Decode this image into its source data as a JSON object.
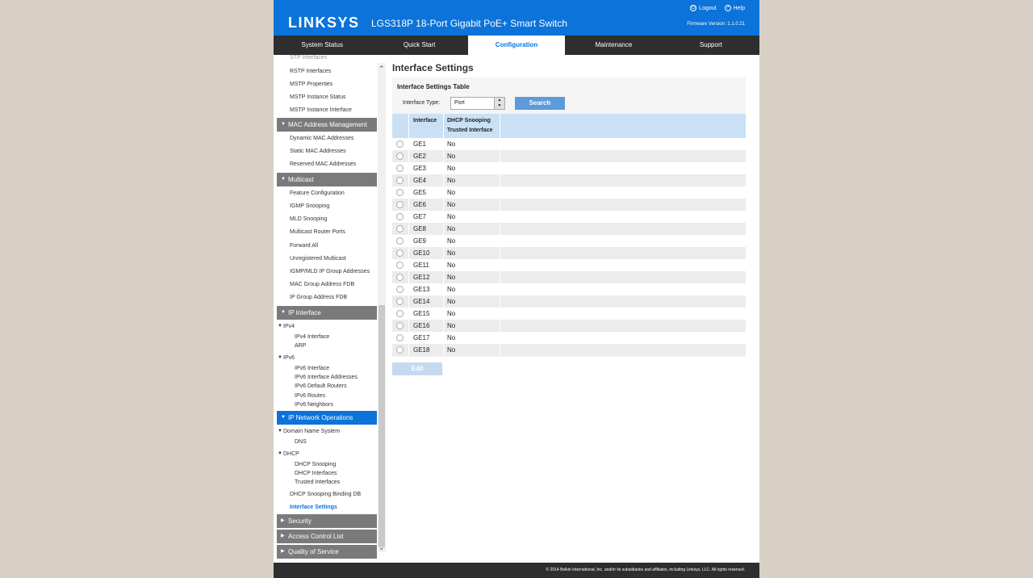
{
  "header": {
    "logo": "LINKSYS",
    "product": "LGS318P 18-Port Gigabit PoE+ Smart Switch",
    "logout": "Logout",
    "help": "Help",
    "firmware": "Firmware Version: 1.1.0.21"
  },
  "tabs": [
    "System Status",
    "Quick Start",
    "Configuration",
    "Maintenance",
    "Support"
  ],
  "active_tab": "Configuration",
  "sidebar": {
    "top_items": [
      "STP Interfaces",
      "RSTP Interfaces",
      "MSTP Properties",
      "MSTP Instance Status",
      "MSTP Instance Interface"
    ],
    "mac_head": "MAC Address Management",
    "mac_items": [
      "Dynamic MAC Addresses",
      "Static MAC Addresses",
      "Reserved MAC Addresses"
    ],
    "multicast_head": "Multicast",
    "multicast_items": [
      "Feature Configuration",
      "IGMP Snooping",
      "MLD Snooping",
      "Multicast Router Ports",
      "Forward All",
      "Unregistered Multicast",
      "IGMP/MLD IP Group Addresses",
      "MAC Group Address FDB",
      "IP Group Address FDB"
    ],
    "ip_head": "IP Interface",
    "ipv4": "IPv4",
    "ipv4_items": [
      "IPv4 Interface",
      "ARP"
    ],
    "ipv6": "IPv6",
    "ipv6_items": [
      "IPv6 Interface",
      "IPv6 Interface Addresses",
      "IPv6 Default Routers",
      "IPv6 Routes",
      "IPv6 Neighbors"
    ],
    "ipnet_head": "IP Network Operations",
    "dns_group": "Domain Name System",
    "dns": "DNS",
    "dhcp_group": "DHCP",
    "dhcp_items": [
      "DHCP Snooping",
      "DHCP Interfaces",
      "Trusted Interfaces"
    ],
    "binding_db": "DHCP Snooping Binding DB",
    "interface_settings": "Interface Settings",
    "security_head": "Security",
    "acl_head": "Access Control List",
    "qos_head": "Quality of Service"
  },
  "main": {
    "title": "Interface Settings",
    "panel_title": "Interface Settings Table",
    "filter_label": "Interface Type:",
    "filter_value": "Port",
    "search_label": "Search",
    "col_interface": "Interface",
    "col_dhcp_1": "DHCP Snooping",
    "col_dhcp_2": "Trusted Interface",
    "rows": [
      {
        "interface": "GE1",
        "trusted": "No"
      },
      {
        "interface": "GE2",
        "trusted": "No"
      },
      {
        "interface": "GE3",
        "trusted": "No"
      },
      {
        "interface": "GE4",
        "trusted": "No"
      },
      {
        "interface": "GE5",
        "trusted": "No"
      },
      {
        "interface": "GE6",
        "trusted": "No"
      },
      {
        "interface": "GE7",
        "trusted": "No"
      },
      {
        "interface": "GE8",
        "trusted": "No"
      },
      {
        "interface": "GE9",
        "trusted": "No"
      },
      {
        "interface": "GE10",
        "trusted": "No"
      },
      {
        "interface": "GE11",
        "trusted": "No"
      },
      {
        "interface": "GE12",
        "trusted": "No"
      },
      {
        "interface": "GE13",
        "trusted": "No"
      },
      {
        "interface": "GE14",
        "trusted": "No"
      },
      {
        "interface": "GE15",
        "trusted": "No"
      },
      {
        "interface": "GE16",
        "trusted": "No"
      },
      {
        "interface": "GE17",
        "trusted": "No"
      },
      {
        "interface": "GE18",
        "trusted": "No"
      }
    ],
    "edit_label": "Edit"
  },
  "footer": {
    "copyright": "© 2014 Belkin International, Inc. and/or its subsidiaries and affiliates, including Linksys, LLC. All rights reserved."
  },
  "colors": {
    "brand_blue": "#0b73d9",
    "tab_bar": "#2e2e2e",
    "section_gray": "#7a7a7a"
  }
}
